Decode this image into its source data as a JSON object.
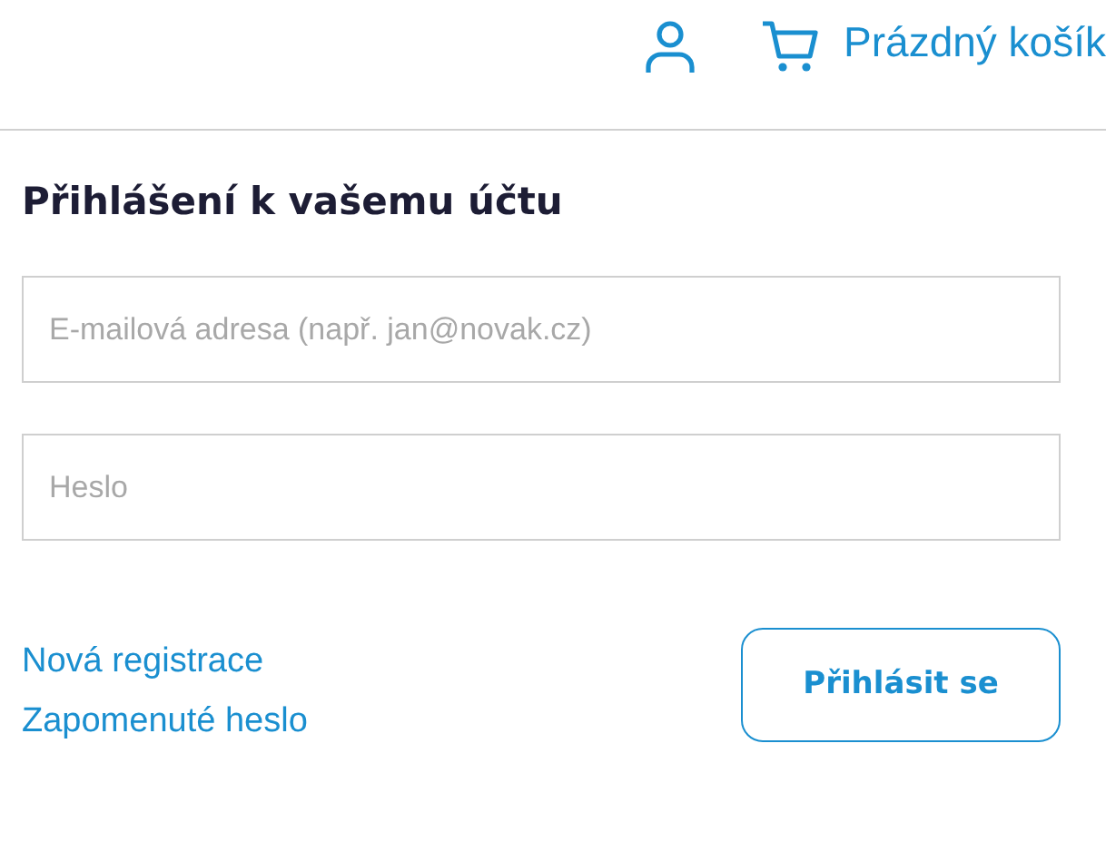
{
  "header": {
    "cart_label": "Prázdný košík"
  },
  "login": {
    "title": "Přihlášení k vašemu účtu",
    "fields": [
      {
        "placeholder": "E-mailová adresa (např. jan@novak.cz)"
      },
      {
        "placeholder": "Heslo"
      }
    ],
    "links": [
      "Nová registrace",
      "Zapomenuté heslo"
    ],
    "submit": "Přihlásit se"
  }
}
